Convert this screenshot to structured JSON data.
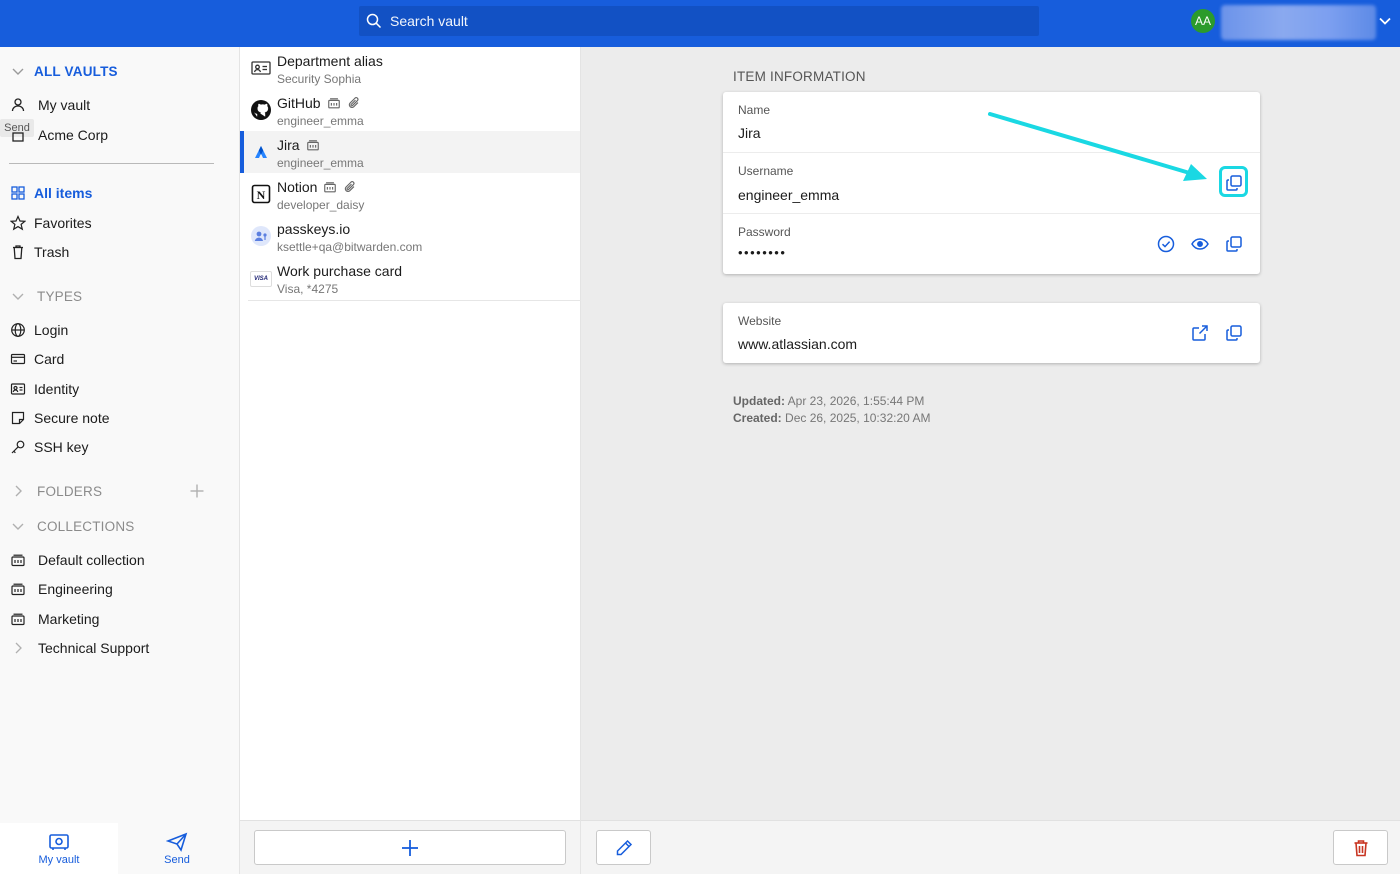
{
  "header": {
    "search_placeholder": "Search vault",
    "avatar_initials": "AA"
  },
  "sidebar": {
    "all_vaults": "ALL VAULTS",
    "vaults": [
      {
        "label": "My vault",
        "icon": "person-icon"
      },
      {
        "label": "Acme Corp",
        "icon": "building-icon"
      }
    ],
    "send_tooltip": "Send",
    "filters": [
      {
        "label": "All items",
        "icon": "grid-icon",
        "active": true
      },
      {
        "label": "Favorites",
        "icon": "star-icon"
      },
      {
        "label": "Trash",
        "icon": "trash-icon"
      }
    ],
    "types_header": "TYPES",
    "types": [
      {
        "label": "Login",
        "icon": "globe-icon"
      },
      {
        "label": "Card",
        "icon": "card-icon"
      },
      {
        "label": "Identity",
        "icon": "id-card-icon"
      },
      {
        "label": "Secure note",
        "icon": "note-icon"
      },
      {
        "label": "SSH key",
        "icon": "key-icon"
      }
    ],
    "folders_header": "FOLDERS",
    "collections_header": "COLLECTIONS",
    "collections": [
      {
        "label": "Default collection",
        "icon": "collection-icon"
      },
      {
        "label": "Engineering",
        "icon": "collection-icon"
      },
      {
        "label": "Marketing",
        "icon": "collection-icon"
      },
      {
        "label": "Technical Support",
        "icon": "chevron-right-icon"
      }
    ],
    "bottom_nav": {
      "my_vault": "My vault",
      "send": "Send"
    }
  },
  "list": {
    "items": [
      {
        "title": "Department alias",
        "subtitle": "Security Sophia",
        "icon": "id-card-icon"
      },
      {
        "title": "GitHub",
        "subtitle": "engineer_emma",
        "icon": "github-icon",
        "shared": true,
        "attachment": true
      },
      {
        "title": "Jira",
        "subtitle": "engineer_emma",
        "icon": "jira-icon",
        "shared": true,
        "selected": true
      },
      {
        "title": "Notion",
        "subtitle": "developer_daisy",
        "icon": "notion-icon",
        "shared": true,
        "attachment": true
      },
      {
        "title": "passkeys.io",
        "subtitle": "ksettle+qa@bitwarden.com",
        "icon": "passkey-icon"
      },
      {
        "title": "Work purchase card",
        "subtitle": "Visa, *4275",
        "icon": "visa-icon",
        "visa_text": "VISA"
      }
    ]
  },
  "detail": {
    "section_title": "ITEM INFORMATION",
    "name_label": "Name",
    "name_value": "Jira",
    "username_label": "Username",
    "username_value": "engineer_emma",
    "password_label": "Password",
    "password_value": "••••••••",
    "website_label": "Website",
    "website_value": "www.atlassian.com",
    "updated_label": "Updated:",
    "updated_value": "Apr 23, 2026, 1:55:44 PM",
    "created_label": "Created:",
    "created_value": "Dec 26, 2025, 10:32:20 AM"
  },
  "colors": {
    "brand": "#175ddc",
    "annotation": "#1ad8e3",
    "danger": "#c83522"
  }
}
